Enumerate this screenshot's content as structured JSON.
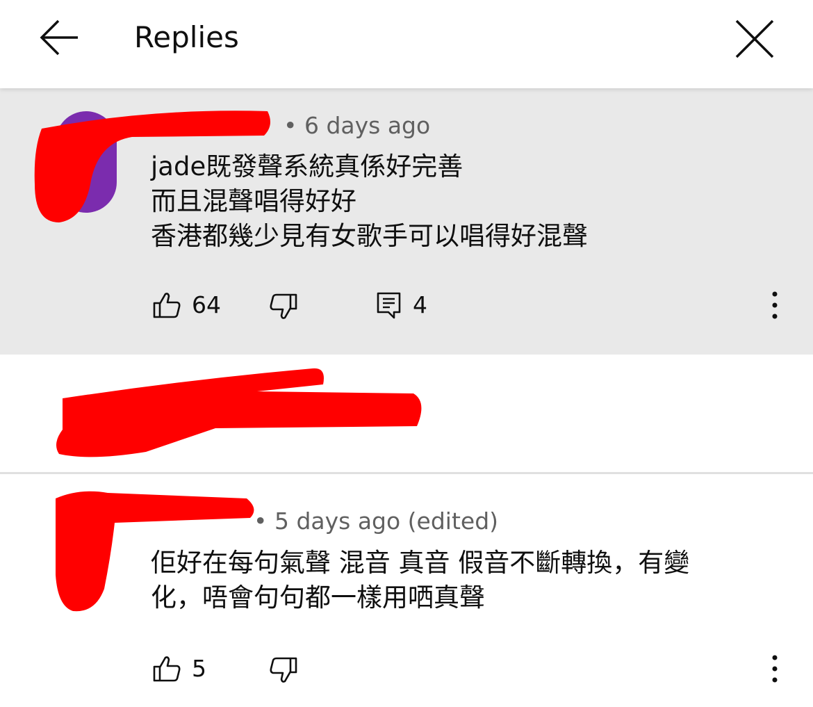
{
  "header": {
    "title": "Replies",
    "back_icon": "arrow-left-icon",
    "close_icon": "close-icon"
  },
  "parent_comment": {
    "meta": "• 6 days ago",
    "text": "jade既發聲系統真係好完善\n而且混聲唱得好好\n香港都幾少見有女歌手可以唱得好混聲",
    "like_count": "64",
    "reply_count": "4"
  },
  "reply": {
    "meta": "• 5 days ago (edited)",
    "text": "佢好在每句氣聲 混音 真音 假音不斷轉換，有變\n化，唔會句句都一樣用哂真聲",
    "like_count": "5"
  },
  "colors": {
    "highlight_bg": "#e9e9e9",
    "redaction": "#ff0000",
    "avatar_purple": "#7b2cae",
    "meta_text": "#606060"
  }
}
